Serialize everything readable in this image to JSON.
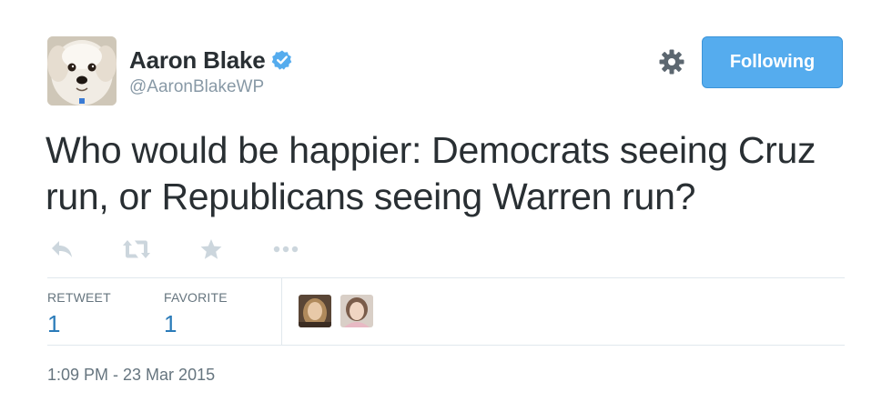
{
  "user": {
    "fullname": "Aaron Blake",
    "handle": "@AaronBlakeWP",
    "verified": true
  },
  "header": {
    "follow_label": "Following",
    "settings_icon": "gear-icon"
  },
  "tweet": {
    "text": "Who would be happier: Democrats seeing Cruz run, or Republicans seeing Warren run?"
  },
  "actions": [
    {
      "name": "reply-icon"
    },
    {
      "name": "retweet-icon"
    },
    {
      "name": "favorite-icon"
    },
    {
      "name": "more-icon"
    }
  ],
  "stats": {
    "retweet_label": "RETWEET",
    "retweet_count": "1",
    "favorite_label": "FAVORITE",
    "favorite_count": "1"
  },
  "timestamp": "1:09 PM - 23 Mar 2015",
  "colors": {
    "accent": "#55acee",
    "link": "#2b7bb9",
    "text": "#292f33",
    "muted": "#8899a6",
    "divider": "#e1e8ed"
  }
}
